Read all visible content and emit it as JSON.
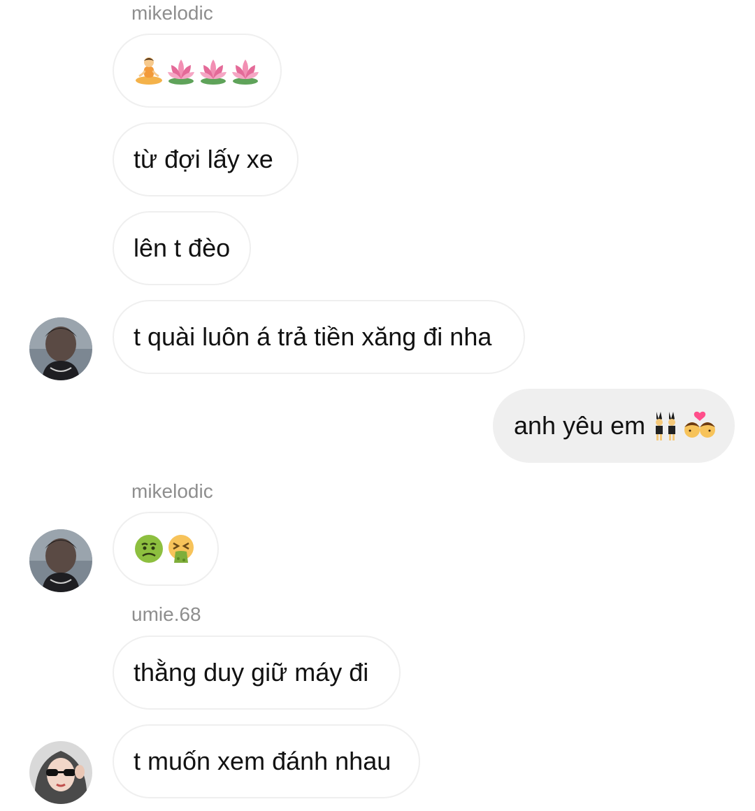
{
  "messages": [
    {
      "sender": "mikelodic",
      "text": "",
      "emoji": [
        "person-in-lotus-position",
        "lotus",
        "lotus",
        "lotus"
      ]
    },
    {
      "text": "từ đợi lấy xe"
    },
    {
      "text": "lên t đèo"
    },
    {
      "text": "t quài luôn á trả tiền xăng đi nha",
      "avatar": "mikelodic-avatar"
    },
    {
      "text": "anh yêu em",
      "outgoing": true,
      "emoji": [
        "people-with-bunny-ears",
        "kiss"
      ]
    },
    {
      "sender": "mikelodic",
      "emoji": [
        "nauseated-face",
        "vomiting-face"
      ],
      "avatar": "mikelodic-avatar"
    },
    {
      "sender": "umie.68",
      "text": "thằng duy giữ máy đi"
    },
    {
      "text": "t muốn xem đánh nhau",
      "avatar": "umie-avatar"
    }
  ],
  "colors": {
    "outgoing_bubble": "#efefef",
    "bubble_border": "#efefef",
    "sender_name": "#8e8e8e",
    "text": "#111111"
  }
}
